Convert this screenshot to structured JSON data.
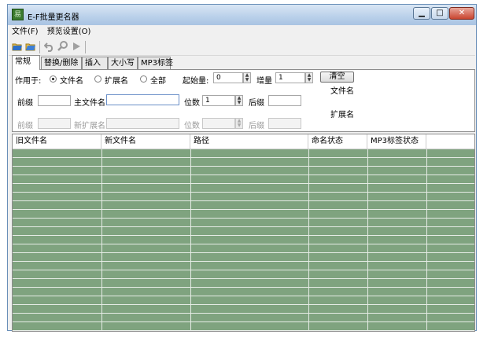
{
  "window": {
    "title": "E-F批量更名器",
    "minimize": "▁",
    "maximize": "□",
    "close": "✕"
  },
  "menu": [
    {
      "label": "文件(F)"
    },
    {
      "label": "预览设置(O)"
    }
  ],
  "toolbar_icons": [
    "open-folder-icon",
    "open-file-icon",
    "undo-icon",
    "search-icon",
    "play-icon"
  ],
  "tabs": [
    {
      "label": "常规",
      "active": true
    },
    {
      "label": "替换/删除"
    },
    {
      "label": "插入"
    },
    {
      "label": "大小写"
    },
    {
      "label": "MP3标签"
    }
  ],
  "general": {
    "apply_to_label": "作用于:",
    "radio_filename": "文件名",
    "radio_ext": "扩展名",
    "radio_all": "全部",
    "selected": "文件名",
    "start_label": "起始量:",
    "start_value": "0",
    "step_label": "增量",
    "step_value": "1",
    "clear_button": "清空",
    "filename_group": "文件名",
    "ext_group": "扩展名",
    "prefix_label": "前缀",
    "main_name_label": "主文件名",
    "digits_label": "位数",
    "digits_value": "1",
    "suffix_label": "后缀",
    "prefix2_label": "前缀",
    "new_ext_label": "新扩展名",
    "digits2_label": "位数",
    "suffix2_label": "后缀"
  },
  "table": {
    "columns": [
      "旧文件名",
      "新文件名",
      "路径",
      "命名状态",
      "MP3标签状态"
    ]
  },
  "colors": {
    "grid_fill": "#7fa37f",
    "title_gradient": "#b9d0ea"
  }
}
